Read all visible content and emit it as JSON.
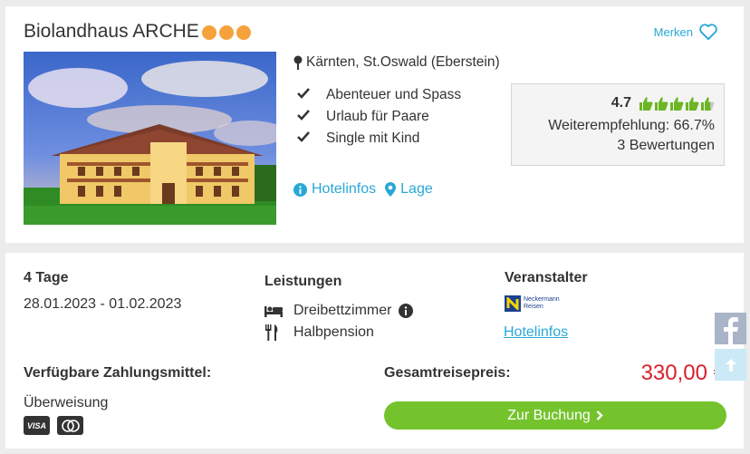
{
  "hotel": {
    "name": "Biolandhaus ARCHE",
    "stars": 3,
    "merken_label": "Merken",
    "location": "Kärnten, St.Oswald (Eberstein)",
    "features": [
      "Abenteuer und Spass",
      "Urlaub für Paare",
      "Single mit Kind"
    ],
    "rating": {
      "score": "4.7",
      "thumbs_filled": 4.7,
      "thumbs_total": 5,
      "recommendation": "Weiterempfehlung: 66.7%",
      "reviews": "3 Bewertungen"
    },
    "links": {
      "hotelinfos": "Hotelinfos",
      "lage": "Lage"
    }
  },
  "offer": {
    "duration": "4 Tage",
    "dates": "28.01.2023 - 01.02.2023",
    "leistungen_label": "Leistungen",
    "leistungen": {
      "room": "Dreibettzimmer",
      "board": "Halbpension"
    },
    "veranstalter_label": "Veranstalter",
    "veranstalter_logo": {
      "line1": "Neckermann",
      "line2": "Reisen"
    },
    "veranstalter_link": "Hotelinfos",
    "payment_label": "Verfügbare Zahlungsmittel:",
    "payment_method": "Überweisung",
    "payment_cards": [
      "VISA",
      "mastercard"
    ],
    "total_label": "Gesamtreisepreis:",
    "price": "330,00 €",
    "book_button": "Zur Buchung"
  },
  "colors": {
    "accent": "#29a8d6",
    "star": "#f6a23c",
    "thumb": "#6cb523",
    "price": "#d9202e",
    "button": "#74c32c"
  },
  "icons": {
    "facebook": "facebook-icon",
    "scroll_top": "arrow-up-icon"
  }
}
